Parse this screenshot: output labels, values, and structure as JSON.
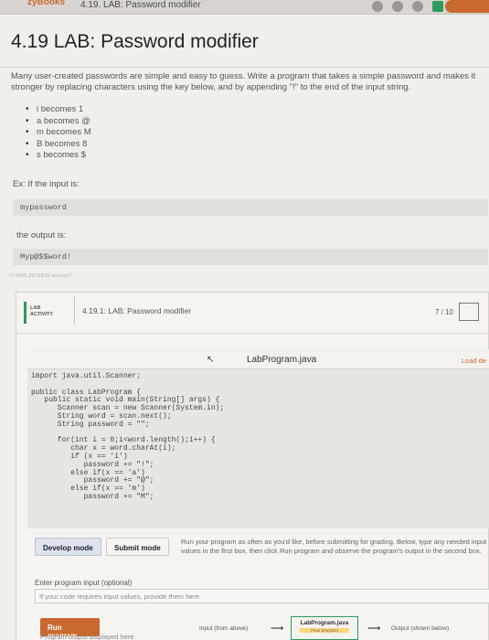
{
  "topbar": {
    "brand": "zyBooks",
    "crumb": "4.19. LAB: Password modifier"
  },
  "page": {
    "title": "4.19 LAB: Password modifier",
    "intro": "Many user-created passwords are simple and easy to guess. Write a program that takes a simple password and makes it stronger by replacing characters using the key below, and by appending \"!\" to the end of the input string.",
    "rules": [
      "i becomes 1",
      "a becomes @",
      "m becomes M",
      "B becomes 8",
      "s becomes $"
    ],
    "example_label": "Ex: If the input is:",
    "example_input": "mypassword",
    "output_label": "the output is:",
    "example_output": "Myp@$$word!",
    "tag": "374966.2576898.qx3zqy7"
  },
  "lab": {
    "badge_line1": "LAB",
    "badge_line2": "ACTIVITY",
    "title": "4.19.1: LAB: Password modifier",
    "score": "7 / 10",
    "filename": "LabProgram.java",
    "load_default": "Load de",
    "code": "import java.util.Scanner;\n\npublic class LabProgram {\n   public static void main(String[] args) {\n      Scanner scan = new Scanner(System.in);\n      String word = scan.next();\n      String password = \"\";\n\n      for(int i = 0;i<word.length();i++) {\n         char x = word.charAt(i);\n         if (x == 'i')\n            password += \"!\";\n         else if(x == 'a')\n            password += \"@\";\n         else if(x == 'm')\n            password += \"M\";",
    "develop_mode": "Develop mode",
    "submit_mode": "Submit mode",
    "run_help": "Run your program as often as you'd like, before submitting for grading. Below, type any needed input values in the first box, then click Run program and observe the program's output in the second box.",
    "input_label": "Enter program input (optional)",
    "input_placeholder": "If your code requires input values, provide them here.",
    "run_program": "Run program",
    "flow_input": "Input (from above)",
    "flow_program": "LabProgram.java",
    "flow_program_sub": "(Your program)",
    "flow_output": "Output (shown below)",
    "output_display": "Program output displayed here"
  }
}
